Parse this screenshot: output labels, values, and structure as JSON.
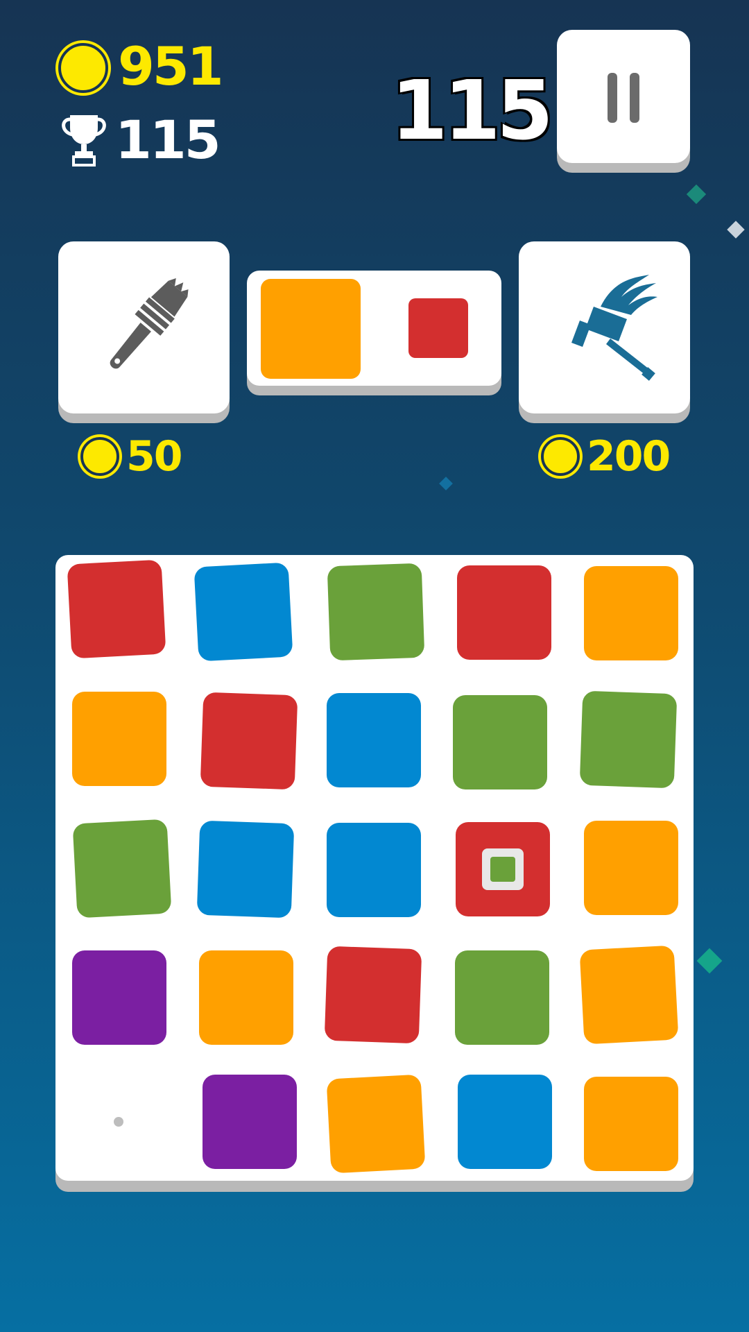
{
  "hud": {
    "coins": "951",
    "best_score": "115",
    "current_score": "115"
  },
  "powerups": {
    "brush": {
      "icon": "paintbrush-icon",
      "price": "50"
    },
    "hammer": {
      "icon": "hammer-icon",
      "price": "200"
    }
  },
  "next_preview": {
    "next_color": "orange",
    "after_color": "red"
  },
  "colors": {
    "red": "#d32f2f",
    "blue": "#0288d1",
    "green": "#6aa13a",
    "orange": "#ffa000",
    "purple": "#7b1fa2",
    "coin": "#fde900"
  },
  "board": {
    "rows": [
      [
        "red",
        "blue",
        "green",
        "red",
        "orange"
      ],
      [
        "orange",
        "red",
        "blue",
        "green",
        "green"
      ],
      [
        "green",
        "blue",
        "blue",
        "red-target",
        "orange"
      ],
      [
        "purple",
        "orange",
        "red",
        "green",
        "orange"
      ],
      [
        "empty",
        "purple",
        "orange",
        "blue",
        "orange"
      ]
    ]
  }
}
